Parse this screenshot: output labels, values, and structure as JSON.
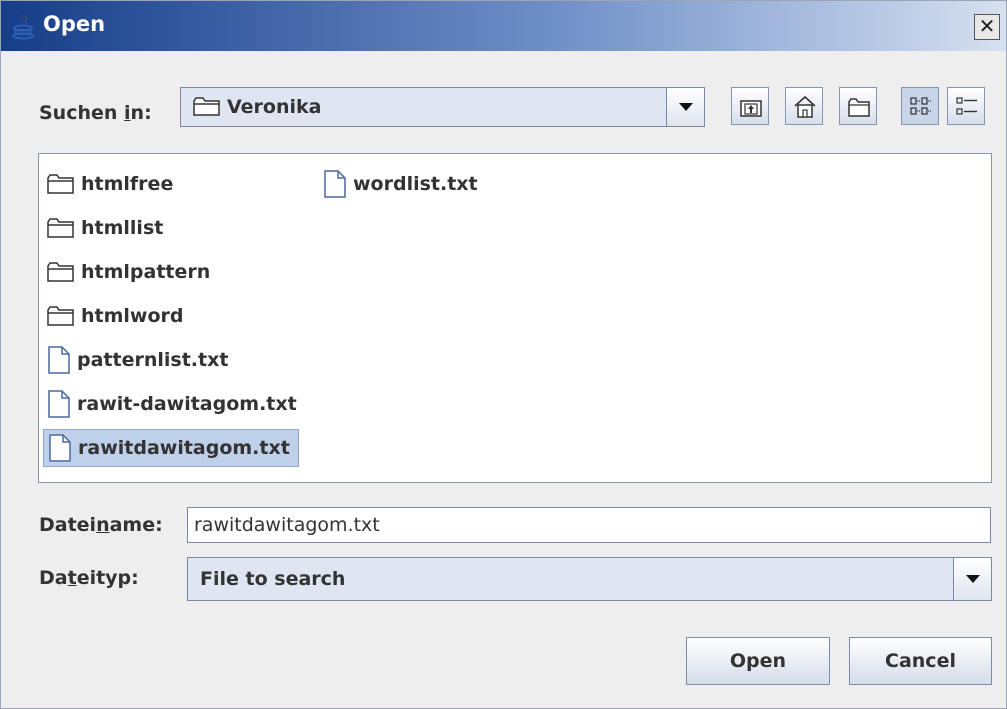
{
  "window": {
    "title": "Open",
    "close_glyph": "✕"
  },
  "lookin": {
    "label_pre": "Suchen ",
    "label_mn": "i",
    "label_post": "n:",
    "value": "Veronika"
  },
  "toolbar": {
    "buttons": [
      {
        "name": "up-one-level",
        "icon": "folder-up-icon"
      },
      {
        "name": "home",
        "icon": "home-icon"
      },
      {
        "name": "new-folder",
        "icon": "new-folder-icon"
      },
      {
        "name": "list-view",
        "icon": "list-view-icon",
        "active": true
      },
      {
        "name": "details-view",
        "icon": "details-view-icon"
      }
    ]
  },
  "files": [
    {
      "name": "htmlfree",
      "type": "folder"
    },
    {
      "name": "htmllist",
      "type": "folder"
    },
    {
      "name": "htmlpattern",
      "type": "folder"
    },
    {
      "name": "htmlword",
      "type": "folder"
    },
    {
      "name": "patternlist.txt",
      "type": "file"
    },
    {
      "name": "rawit-dawitagom.txt",
      "type": "file"
    },
    {
      "name": "rawitdawitagom.txt",
      "type": "file",
      "selected": true
    },
    {
      "name": "wordlist.txt",
      "type": "file"
    }
  ],
  "filename": {
    "label_pre": "Datei",
    "label_mn": "n",
    "label_post": "ame:",
    "value": "rawitdawitagom.txt"
  },
  "filetype": {
    "label_pre": "Da",
    "label_mn": "t",
    "label_post": "eityp:",
    "value": "File to search"
  },
  "buttons": {
    "open": "Open",
    "cancel": "Cancel"
  },
  "colors": {
    "title_start": "#163d88",
    "selection": "#bfd0ea"
  }
}
